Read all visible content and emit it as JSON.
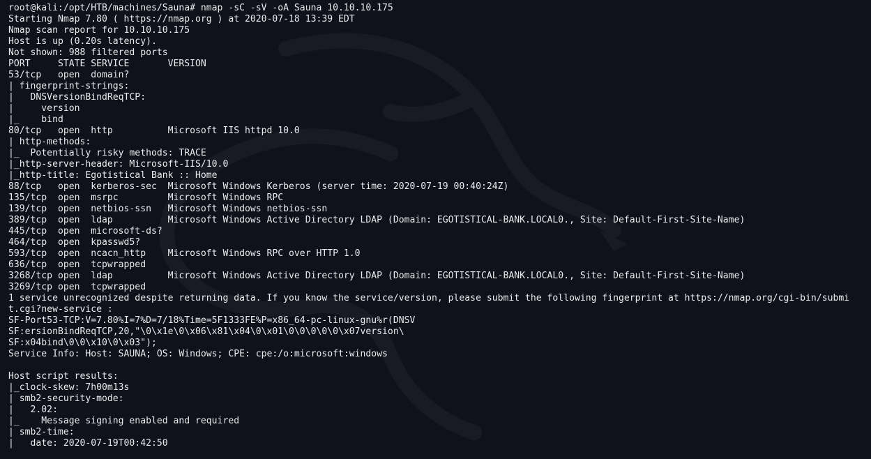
{
  "terminal": {
    "lines": [
      "root@kali:/opt/HTB/machines/Sauna# nmap -sC -sV -oA Sauna 10.10.10.175",
      "Starting Nmap 7.80 ( https://nmap.org ) at 2020-07-18 13:39 EDT",
      "Nmap scan report for 10.10.10.175",
      "Host is up (0.20s latency).",
      "Not shown: 988 filtered ports",
      "PORT     STATE SERVICE       VERSION",
      "53/tcp   open  domain?",
      "| fingerprint-strings:",
      "|   DNSVersionBindReqTCP:",
      "|     version",
      "|_    bind",
      "80/tcp   open  http          Microsoft IIS httpd 10.0",
      "| http-methods:",
      "|_  Potentially risky methods: TRACE",
      "|_http-server-header: Microsoft-IIS/10.0",
      "|_http-title: Egotistical Bank :: Home",
      "88/tcp   open  kerberos-sec  Microsoft Windows Kerberos (server time: 2020-07-19 00:40:24Z)",
      "135/tcp  open  msrpc         Microsoft Windows RPC",
      "139/tcp  open  netbios-ssn   Microsoft Windows netbios-ssn",
      "389/tcp  open  ldap          Microsoft Windows Active Directory LDAP (Domain: EGOTISTICAL-BANK.LOCAL0., Site: Default-First-Site-Name)",
      "445/tcp  open  microsoft-ds?",
      "464/tcp  open  kpasswd5?",
      "593/tcp  open  ncacn_http    Microsoft Windows RPC over HTTP 1.0",
      "636/tcp  open  tcpwrapped",
      "3268/tcp open  ldap          Microsoft Windows Active Directory LDAP (Domain: EGOTISTICAL-BANK.LOCAL0., Site: Default-First-Site-Name)",
      "3269/tcp open  tcpwrapped",
      "1 service unrecognized despite returning data. If you know the service/version, please submit the following fingerprint at https://nmap.org/cgi-bin/submi",
      "t.cgi?new-service :",
      "SF-Port53-TCP:V=7.80%I=7%D=7/18%Time=5F1333FE%P=x86_64-pc-linux-gnu%r(DNSV",
      "SF:ersionBindReqTCP,20,\"\\0\\x1e\\0\\x06\\x81\\x04\\0\\x01\\0\\0\\0\\0\\0\\x07version\\",
      "SF:x04bind\\0\\0\\x10\\0\\x03\");",
      "Service Info: Host: SAUNA; OS: Windows; CPE: cpe:/o:microsoft:windows",
      "",
      "Host script results:",
      "|_clock-skew: 7h00m13s",
      "| smb2-security-mode:",
      "|   2.02:",
      "|_    Message signing enabled and required",
      "| smb2-time:",
      "|   date: 2020-07-19T00:42:50"
    ]
  },
  "colors": {
    "background": "#10111a",
    "text": "#e9ebef",
    "watermark": "#1b1d26"
  }
}
